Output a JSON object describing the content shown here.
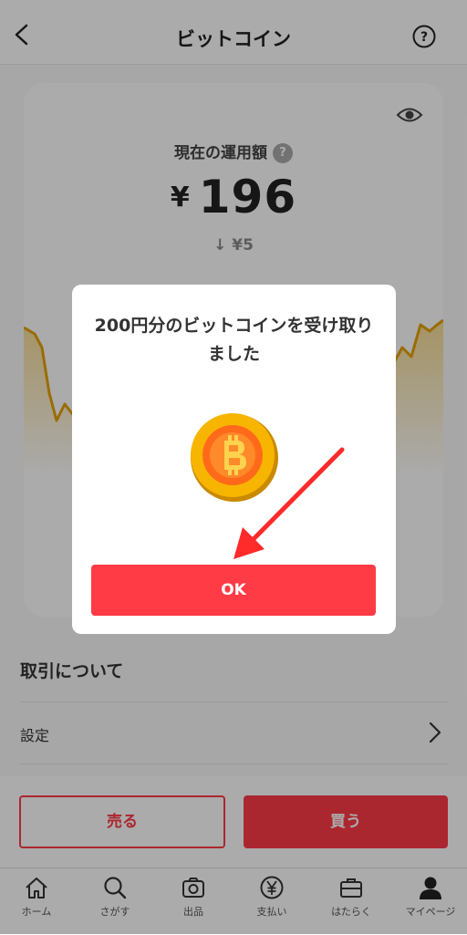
{
  "header": {
    "title": "ビットコイン"
  },
  "balance": {
    "label": "現在の運用額",
    "help_glyph": "?",
    "currency": "¥",
    "value": "196",
    "change": "↓ ¥5"
  },
  "section": {
    "title": "取引について"
  },
  "settings": {
    "label": "設定"
  },
  "actions": {
    "sell": "売る",
    "buy": "買う"
  },
  "tabs": [
    {
      "label": "ホーム",
      "icon": "home-icon"
    },
    {
      "label": "さがす",
      "icon": "search-icon"
    },
    {
      "label": "出品",
      "icon": "camera-icon"
    },
    {
      "label": "支払い",
      "icon": "yen-circle-icon"
    },
    {
      "label": "はたらく",
      "icon": "briefcase-icon"
    },
    {
      "label": "マイページ",
      "icon": "person-icon"
    }
  ],
  "dialog": {
    "message": "200円分のビットコインを受け取りました",
    "ok": "OK"
  },
  "colors": {
    "accent": "#ff3b46",
    "chart_line": "#e8a100",
    "coin": "#f7b500"
  }
}
